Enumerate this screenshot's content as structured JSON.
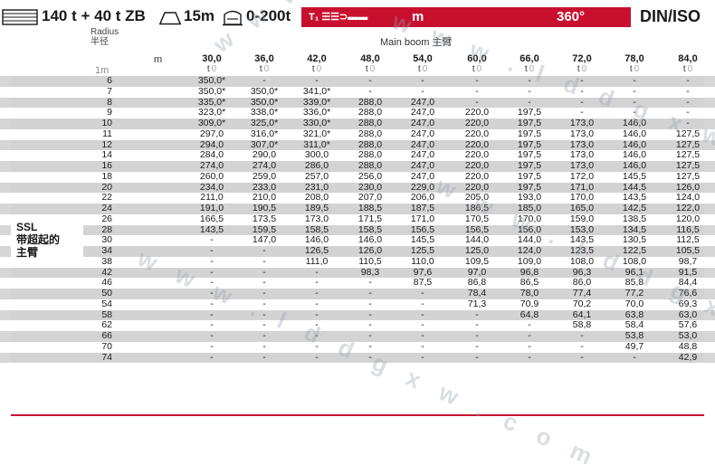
{
  "header": {
    "counterweight": "140 t + 40 t ZB",
    "outrigger_span": "15m",
    "capacity_range": "0-200t",
    "config_code": "T₁ ☰☰⊃▬▬",
    "unit": "m",
    "slew_angle": "360°",
    "standard": "DIN/ISO"
  },
  "labels": {
    "radius_en": "Radius",
    "radius_cn": "半径",
    "main_boom": "Main boom 主臂",
    "m_unit": "m",
    "radius_unit": "1m",
    "ssl_line1": "SSL",
    "ssl_line2": "带超起的",
    "ssl_line3": "主臂"
  },
  "columns": [
    {
      "boom": "30,0",
      "unit": "t"
    },
    {
      "boom": "36,0",
      "unit": "t"
    },
    {
      "boom": "42,0",
      "unit": "t"
    },
    {
      "boom": "48,0",
      "unit": "t"
    },
    {
      "boom": "54,0",
      "unit": "t"
    },
    {
      "boom": "60,0",
      "unit": "t"
    },
    {
      "boom": "66,0",
      "unit": "t"
    },
    {
      "boom": "72,0",
      "unit": "t"
    },
    {
      "boom": "78,0",
      "unit": "t"
    },
    {
      "boom": "84,0",
      "unit": "t"
    }
  ],
  "rows": [
    {
      "radius": "6",
      "values": [
        "350,0*",
        "-",
        "-",
        "-",
        "-",
        "-",
        "-",
        "-",
        "-",
        "-"
      ]
    },
    {
      "radius": "7",
      "values": [
        "350,0*",
        "350,0*",
        "341,0*",
        "-",
        "-",
        "-",
        "-",
        "-",
        "-",
        "-"
      ]
    },
    {
      "radius": "8",
      "values": [
        "335,0*",
        "350,0*",
        "339,0*",
        "288,0",
        "247,0",
        "-",
        "-",
        "-",
        "-",
        "-"
      ]
    },
    {
      "radius": "9",
      "values": [
        "323,0*",
        "338,0*",
        "336,0*",
        "288,0",
        "247,0",
        "220,0",
        "197,5",
        "-",
        "-",
        "-"
      ]
    },
    {
      "radius": "10",
      "values": [
        "309,0*",
        "325,0*",
        "330,0*",
        "288,0",
        "247,0",
        "220,0",
        "197,5",
        "173,0",
        "146,0",
        "-"
      ]
    },
    {
      "radius": "11",
      "values": [
        "297,0",
        "316,0*",
        "321,0*",
        "288,0",
        "247,0",
        "220,0",
        "197,5",
        "173,0",
        "146,0",
        "127,5"
      ]
    },
    {
      "radius": "12",
      "values": [
        "294,0",
        "307,0*",
        "311,0*",
        "288,0",
        "247,0",
        "220,0",
        "197,5",
        "173,0",
        "146,0",
        "127,5"
      ]
    },
    {
      "radius": "14",
      "values": [
        "284,0",
        "290,0",
        "300,0",
        "288,0",
        "247,0",
        "220,0",
        "197,5",
        "173,0",
        "146,0",
        "127,5"
      ]
    },
    {
      "radius": "16",
      "values": [
        "274,0",
        "274,0",
        "286,0",
        "288,0",
        "247,0",
        "220,0",
        "197,5",
        "173,0",
        "146,0",
        "127,5"
      ]
    },
    {
      "radius": "18",
      "values": [
        "260,0",
        "259,0",
        "257,0",
        "256,0",
        "247,0",
        "220,0",
        "197,5",
        "172,0",
        "145,5",
        "127,5"
      ]
    },
    {
      "radius": "20",
      "values": [
        "234,0",
        "233,0",
        "231,0",
        "230,0",
        "229,0",
        "220,0",
        "197,5",
        "171,0",
        "144,5",
        "126,0"
      ]
    },
    {
      "radius": "22",
      "values": [
        "211,0",
        "210,0",
        "208,0",
        "207,0",
        "206,0",
        "205,0",
        "193,0",
        "170,0",
        "143,5",
        "124,0"
      ]
    },
    {
      "radius": "24",
      "values": [
        "191,0",
        "190,5",
        "189,5",
        "188,5",
        "187,5",
        "186,5",
        "185,0",
        "165,0",
        "142,5",
        "122,0"
      ]
    },
    {
      "radius": "26",
      "values": [
        "166,5",
        "173,5",
        "173,0",
        "171,5",
        "171,0",
        "170,5",
        "170,0",
        "159,0",
        "138,5",
        "120,0"
      ]
    },
    {
      "radius": "28",
      "values": [
        "143,5",
        "159,5",
        "158,5",
        "158,5",
        "156,5",
        "156,5",
        "156,0",
        "153,0",
        "134,5",
        "116,5"
      ]
    },
    {
      "radius": "30",
      "values": [
        "-",
        "147,0",
        "146,0",
        "146,0",
        "145,5",
        "144,0",
        "144,0",
        "143,5",
        "130,5",
        "112,5"
      ]
    },
    {
      "radius": "34",
      "values": [
        "-",
        "-",
        "126,5",
        "126,0",
        "125,5",
        "125,0",
        "124,0",
        "123,5",
        "122,5",
        "105,5"
      ]
    },
    {
      "radius": "38",
      "values": [
        "-",
        "-",
        "111,0",
        "110,5",
        "110,0",
        "109,5",
        "109,0",
        "108,0",
        "108,0",
        "98,7"
      ]
    },
    {
      "radius": "42",
      "values": [
        "-",
        "-",
        "-",
        "98,3",
        "97,6",
        "97,0",
        "96,8",
        "96,3",
        "96,1",
        "91,5"
      ]
    },
    {
      "radius": "46",
      "values": [
        "-",
        "-",
        "-",
        "-",
        "87,5",
        "86,8",
        "86,5",
        "86,0",
        "85,8",
        "84,4"
      ]
    },
    {
      "radius": "50",
      "values": [
        "-",
        "-",
        "-",
        "-",
        "-",
        "78,4",
        "78,0",
        "77,4",
        "77,2",
        "76,6"
      ]
    },
    {
      "radius": "54",
      "values": [
        "-",
        "-",
        "-",
        "-",
        "-",
        "71,3",
        "70,9",
        "70,2",
        "70,0",
        "69,3"
      ]
    },
    {
      "radius": "58",
      "values": [
        "-",
        "-",
        "-",
        "-",
        "-",
        "-",
        "64,8",
        "64,1",
        "63,8",
        "63,0"
      ]
    },
    {
      "radius": "62",
      "values": [
        "-",
        "-",
        "-",
        "-",
        "-",
        "-",
        "-",
        "58,8",
        "58,4",
        "57,6"
      ]
    },
    {
      "radius": "66",
      "values": [
        "-",
        "-",
        "-",
        "-",
        "-",
        "-",
        "-",
        "-",
        "53,8",
        "53,0"
      ]
    },
    {
      "radius": "70",
      "values": [
        "-",
        "-",
        "-",
        "-",
        "-",
        "-",
        "-",
        "-",
        "49,7",
        "48,8"
      ]
    },
    {
      "radius": "74",
      "values": [
        "-",
        "-",
        "-",
        "-",
        "-",
        "-",
        "-",
        "-",
        "-",
        "42,9"
      ]
    }
  ],
  "colors": {
    "brand_red": "#c8102e",
    "row_shade": "#d3d3d3"
  },
  "watermark_text": "w w w . l d d g x w . c o m"
}
